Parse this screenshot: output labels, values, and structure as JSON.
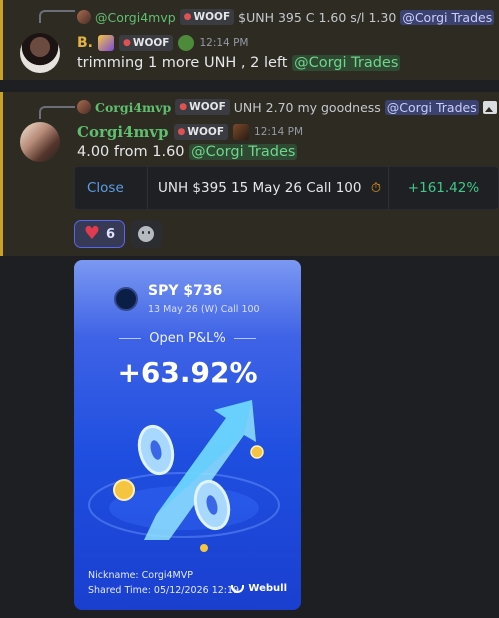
{
  "message1": {
    "reply": {
      "username": "@Corgi4mvp",
      "tag": "WOOF",
      "text": "$UNH 395 C 1.60 s/l 1.30",
      "mention": "@Corgi Trades"
    },
    "author": "B.",
    "tag": "WOOF",
    "timestamp": "12:14 PM",
    "content": "trimming 1 more UNH , 2 left",
    "mention": "@Corgi Trades"
  },
  "message2": {
    "reply": {
      "username": "Corgi4mvp",
      "tag": "WOOF",
      "text": "UNH 2.70  my goodness",
      "mention": "@Corgi Trades",
      "image_icon": "image-icon"
    },
    "author": "Corgi4mvp",
    "tag": "WOOF",
    "timestamp": "12:14 PM",
    "content": "4.00 from 1.60",
    "mention": "@Corgi Trades",
    "embed": {
      "action": "Close",
      "contract": "UNH $395 15 May 26 Call 100",
      "icon": "clock-icon",
      "pnl": "+161.42%"
    },
    "reactions": [
      {
        "emoji": "heart-icon",
        "count": "6"
      }
    ]
  },
  "card": {
    "ticker": "SPY $736",
    "contract": "13 May 26 (W) Call 100",
    "label": "Open P&L%",
    "value": "+63.92%",
    "nickname": "Nickname: Corgi4MVP",
    "shared_time": "Shared Time: 05/12/2026 12:19",
    "brand": "Webull"
  },
  "colors": {
    "message_bg": "#2e2b23",
    "highlight_bar": "#c9a227",
    "mention_bg": "#3c4270",
    "green_mention": "#6fd68b",
    "gain_green": "#3fc987",
    "card_blue": "#1f4fe0"
  }
}
